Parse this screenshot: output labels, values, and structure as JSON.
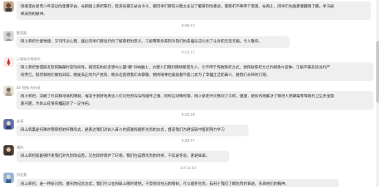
{
  "messages": [
    {
      "name": "",
      "lines": [
        "网络现在是青少年活动的重要平台，在网络上祭祀英烈，既迎往事又结合今义，使同学们更有兴致去主动了解英烈的事迹，使祭祀不再停于表面。在网上，同学们也能更便捷得了解，学习前",
        "辈英烈的精神。"
      ]
    },
    {
      "time": "9:06:43"
    },
    {
      "name": "曹慧勤",
      "lines": [
        "网上祭祀方便快捷，又可传达心意，能让同学们更加好的了解祭祀的意义。江姐等革命英烈为我们的幸福生活付出了生命而无怨无悔，令人敬仰。"
      ]
    },
    {
      "time": "9:12:22"
    },
    {
      "name": "三班班长蒋嘉杰",
      "lines": [
        "网上祭祀是借助互联网跨越时空的特性，将现实的纪念馆与公墓\"搬\"到电脑上，方便人们随时随地祭奠先人。它不停于传统祭祀方式，是传统祭祀方式的继承与延伸。江姐不畏反动派的严",
        "刑拷打，毅然和他们做抗到底。她是真正的共产党员，她永远值得我们去尊敬。她的精神也激励着华夏儿女为了幸福生活而奋斗，是我们永恒的灯塔。"
      ]
    },
    {
      "name": "18-物热-何大豪",
      "lines": [
        "网上祭祀，突破了时间和地域的限制，有助于更好地表达人们对先烈深深的缅怀之情。同时在特殊时期，网上祭祀不仅做到了文明、便捷，更有效地解决了祭祀人员聚集等导致的卫生安全隐",
        "患问题，为防止疫情传播起到了一定作用。"
      ]
    },
    {
      "time": "9:20:38"
    },
    {
      "name": "肖琛",
      "lines": [
        "网上祭奠是特殊时期祭祀的特殊形式，是表达我们对前人奋斗的感激和缅怀先烈的仪式，督促我们为建设新中国而努力学习"
      ]
    },
    {
      "time": "9:32:47"
    },
    {
      "name": "潘莉",
      "lines": [
        "网上祭祀既能够抒发我们对先烈的追思，又在同时保护了环境。我们在追思先烈的时候，不仅是怀念，更是继承。"
      ]
    },
    {
      "time": "10:14:10"
    },
    {
      "name": "刘伦鑫",
      "lines": [
        "网上祭祀，是一种新兴的，便利的纪念方式，我们可以在网络上随时随地，不受时间地点的限制，可以缅怀先烈。有利于我们了解先烈的事迹，传承他们的精神。"
      ]
    }
  ],
  "colors": {
    "bubble": "#efefef",
    "time": "#8a8a8a",
    "name": "#8a8a8a",
    "text": "#222222"
  }
}
